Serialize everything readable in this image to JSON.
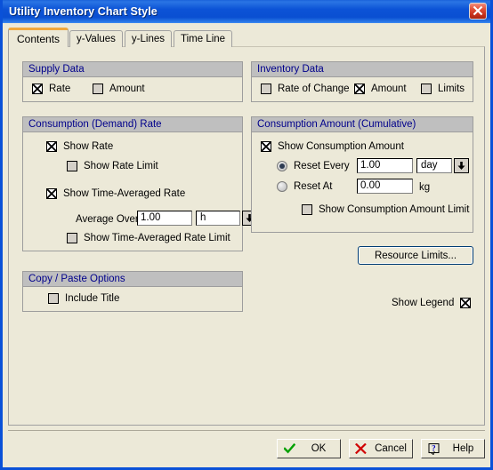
{
  "window": {
    "title": "Utility Inventory Chart Style",
    "close_icon": "close-icon",
    "accent_color": "#0a51d8",
    "face_color": "#ece9d8",
    "group_header_color": "#bfbfbf",
    "group_title_color": "#00008b"
  },
  "tabs": [
    {
      "label": "Contents",
      "selected": true
    },
    {
      "label": "y-Values",
      "selected": false
    },
    {
      "label": "y-Lines",
      "selected": false
    },
    {
      "label": "Time Line",
      "selected": false
    }
  ],
  "groups": {
    "supply_data": {
      "title": "Supply Data",
      "checkboxes": [
        {
          "label": "Rate",
          "checked": true
        },
        {
          "label": "Amount",
          "checked": false
        }
      ]
    },
    "inventory_data": {
      "title": "Inventory Data",
      "checkboxes": [
        {
          "label": "Rate of Change",
          "checked": false
        },
        {
          "label": "Amount",
          "checked": true
        },
        {
          "label": "Limits",
          "checked": false
        }
      ]
    },
    "consumption_rate": {
      "title": "Consumption (Demand) Rate",
      "show_rate": {
        "label": "Show Rate",
        "checked": true
      },
      "show_rate_limit": {
        "label": "Show Rate Limit",
        "checked": false
      },
      "show_time_averaged_rate": {
        "label": "Show Time-Averaged Rate",
        "checked": true
      },
      "average_over_label": "Average Over",
      "average_over_value": "1.00",
      "average_over_unit": "h",
      "average_over_unit_icon": "chevron-down-icon",
      "show_time_averaged_rate_limit": {
        "label": "Show Time-Averaged Rate Limit",
        "checked": false
      }
    },
    "consumption_amount": {
      "title": "Consumption Amount (Cumulative)",
      "show_consumption_amount": {
        "label": "Show Consumption Amount",
        "checked": true
      },
      "reset_every": {
        "label": "Reset Every",
        "selected": true,
        "value": "1.00",
        "unit": "day",
        "unit_icon": "chevron-down-icon"
      },
      "reset_at": {
        "label": "Reset At",
        "selected": false,
        "value": "0.00",
        "unit": "kg"
      },
      "show_consumption_amount_limit": {
        "label": "Show Consumption Amount Limit",
        "checked": false
      }
    },
    "copy_paste": {
      "title": "Copy / Paste Options",
      "include_title": {
        "label": "Include Title",
        "checked": false
      }
    }
  },
  "resource_limits_button": {
    "label": "Resource Limits..."
  },
  "show_legend": {
    "label": "Show Legend",
    "checked": true
  },
  "footer": {
    "ok": {
      "label": "OK",
      "icon": "check-icon"
    },
    "cancel": {
      "label": "Cancel",
      "icon": "x-icon"
    },
    "help": {
      "label": "Help",
      "icon": "question-icon"
    }
  }
}
